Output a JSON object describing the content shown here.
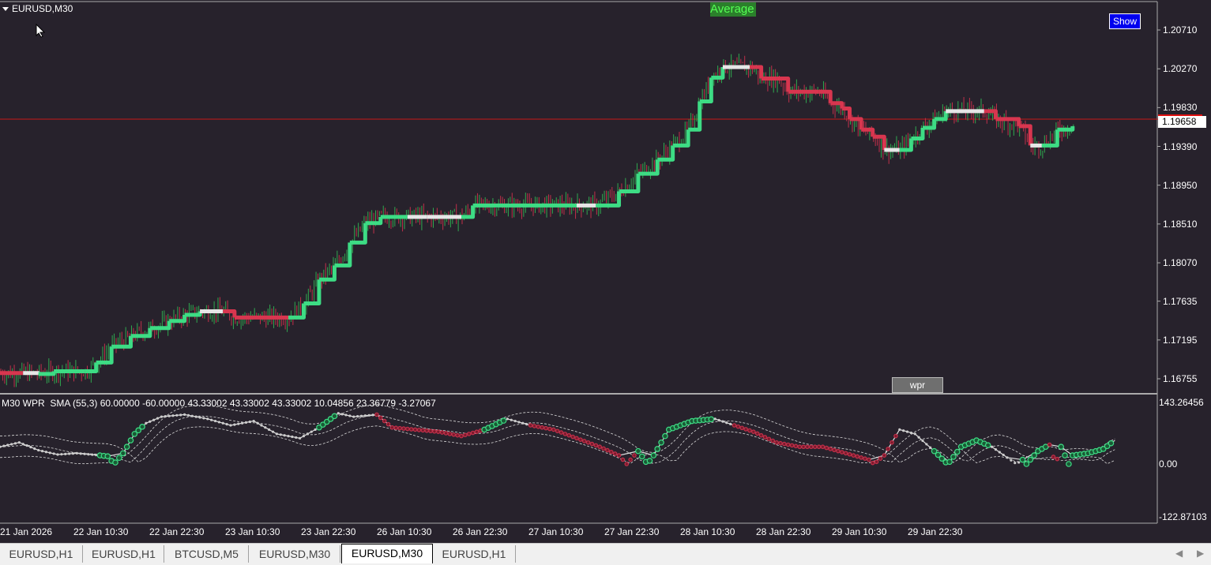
{
  "chart": {
    "symbol_title": "EURUSD,M30",
    "average_button": "Average",
    "show_button": "Show",
    "wpr_button": "wpr",
    "current_price": "1.19658",
    "price_axis": [
      "1.20710",
      "1.20270",
      "1.19830",
      "1.19390",
      "1.18950",
      "1.18510",
      "1.18070",
      "1.17635",
      "1.17195",
      "1.16755"
    ],
    "price_range": [
      1.1662,
      1.2095
    ],
    "colors": {
      "background": "#27222c",
      "bull_candle": "#2fa84f",
      "bear_candle": "#c0304a",
      "trend_up": "#3ddc84",
      "trend_down": "#d8364f",
      "trend_neutral": "#e6e6e6",
      "current_price_line": "#c81818"
    },
    "trend_line": [
      {
        "t": 0,
        "p": 1.1682,
        "s": "d"
      },
      {
        "t": 12,
        "p": 1.1682,
        "s": "d"
      },
      {
        "t": 20,
        "p": 1.1681,
        "s": "n"
      },
      {
        "t": 28,
        "p": 1.1684,
        "s": "u"
      },
      {
        "t": 44,
        "p": 1.1684,
        "s": "u"
      },
      {
        "t": 50,
        "p": 1.1694,
        "s": "u"
      },
      {
        "t": 58,
        "p": 1.1712,
        "s": "u"
      },
      {
        "t": 68,
        "p": 1.1724,
        "s": "u"
      },
      {
        "t": 78,
        "p": 1.1733,
        "s": "u"
      },
      {
        "t": 88,
        "p": 1.1741,
        "s": "u"
      },
      {
        "t": 96,
        "p": 1.1748,
        "s": "u"
      },
      {
        "t": 104,
        "p": 1.1752,
        "s": "u"
      },
      {
        "t": 116,
        "p": 1.1752,
        "s": "n"
      },
      {
        "t": 122,
        "p": 1.1745,
        "s": "d"
      },
      {
        "t": 150,
        "p": 1.1745,
        "s": "d"
      },
      {
        "t": 158,
        "p": 1.1761,
        "s": "u"
      },
      {
        "t": 166,
        "p": 1.1788,
        "s": "u"
      },
      {
        "t": 174,
        "p": 1.1804,
        "s": "u"
      },
      {
        "t": 182,
        "p": 1.183,
        "s": "u"
      },
      {
        "t": 190,
        "p": 1.1852,
        "s": "u"
      },
      {
        "t": 198,
        "p": 1.1859,
        "s": "u"
      },
      {
        "t": 212,
        "p": 1.1859,
        "s": "u"
      },
      {
        "t": 222,
        "p": 1.1859,
        "s": "n"
      },
      {
        "t": 240,
        "p": 1.1859,
        "s": "n"
      },
      {
        "t": 246,
        "p": 1.1872,
        "s": "u"
      },
      {
        "t": 300,
        "p": 1.1872,
        "s": "u"
      },
      {
        "t": 310,
        "p": 1.1872,
        "s": "n"
      },
      {
        "t": 322,
        "p": 1.1888,
        "s": "u"
      },
      {
        "t": 332,
        "p": 1.1908,
        "s": "u"
      },
      {
        "t": 342,
        "p": 1.1924,
        "s": "u"
      },
      {
        "t": 350,
        "p": 1.194,
        "s": "u"
      },
      {
        "t": 358,
        "p": 1.1958,
        "s": "u"
      },
      {
        "t": 364,
        "p": 1.199,
        "s": "u"
      },
      {
        "t": 370,
        "p": 1.2017,
        "s": "u"
      },
      {
        "t": 376,
        "p": 1.2029,
        "s": "u"
      },
      {
        "t": 390,
        "p": 1.2029,
        "s": "n"
      },
      {
        "t": 396,
        "p": 1.2016,
        "s": "d"
      },
      {
        "t": 404,
        "p": 1.2016,
        "s": "d"
      },
      {
        "t": 410,
        "p": 1.2001,
        "s": "d"
      },
      {
        "t": 426,
        "p": 1.2001,
        "s": "d"
      },
      {
        "t": 432,
        "p": 1.1988,
        "s": "d"
      },
      {
        "t": 438,
        "p": 1.1982,
        "s": "d"
      },
      {
        "t": 442,
        "p": 1.197,
        "s": "d"
      },
      {
        "t": 448,
        "p": 1.1958,
        "s": "d"
      },
      {
        "t": 454,
        "p": 1.195,
        "s": "d"
      },
      {
        "t": 460,
        "p": 1.1935,
        "s": "d"
      },
      {
        "t": 468,
        "p": 1.1935,
        "s": "n"
      },
      {
        "t": 474,
        "p": 1.1948,
        "s": "u"
      },
      {
        "t": 480,
        "p": 1.196,
        "s": "u"
      },
      {
        "t": 486,
        "p": 1.197,
        "s": "u"
      },
      {
        "t": 492,
        "p": 1.1979,
        "s": "u"
      },
      {
        "t": 512,
        "p": 1.1979,
        "s": "n"
      },
      {
        "t": 518,
        "p": 1.197,
        "s": "d"
      },
      {
        "t": 530,
        "p": 1.1962,
        "s": "d"
      },
      {
        "t": 536,
        "p": 1.194,
        "s": "d"
      },
      {
        "t": 542,
        "p": 1.194,
        "s": "n"
      },
      {
        "t": 550,
        "p": 1.1958,
        "s": "u"
      },
      {
        "t": 558,
        "p": 1.1962,
        "s": "u"
      }
    ],
    "candle_seed": 7
  },
  "indicator": {
    "title": "M30 WPR  SMA (55,3) 60.00000 -60.00000 43.33002 43.33002 43.33002 10.04856 23.36779 -3.27067",
    "axis": [
      "143.26456",
      "0.00",
      "-122.87103"
    ],
    "range": [
      -122.87103,
      143.26456
    ],
    "dot_colors": {
      "up": "#3ddc84",
      "down": "#c0304a",
      "neutral": "#cccccc"
    },
    "wpr": [
      {
        "t": 0,
        "v": -40,
        "s": "n"
      },
      {
        "t": 10,
        "v": -50,
        "s": "n"
      },
      {
        "t": 20,
        "v": -32,
        "s": "n"
      },
      {
        "t": 30,
        "v": -22,
        "s": "n"
      },
      {
        "t": 40,
        "v": -25,
        "s": "n"
      },
      {
        "t": 52,
        "v": -20,
        "s": "n"
      },
      {
        "t": 56,
        "v": -18,
        "s": "u"
      },
      {
        "t": 64,
        "v": 25,
        "s": "u"
      },
      {
        "t": 70,
        "v": 70,
        "s": "u"
      },
      {
        "t": 76,
        "v": 95,
        "s": "u"
      },
      {
        "t": 84,
        "v": 110,
        "s": "n"
      },
      {
        "t": 96,
        "v": 115,
        "s": "n"
      },
      {
        "t": 108,
        "v": 105,
        "s": "n"
      },
      {
        "t": 120,
        "v": 90,
        "s": "n"
      },
      {
        "t": 132,
        "v": 100,
        "s": "n"
      },
      {
        "t": 144,
        "v": 70,
        "s": "n"
      },
      {
        "t": 156,
        "v": 60,
        "s": "n"
      },
      {
        "t": 166,
        "v": 85,
        "s": "n"
      },
      {
        "t": 176,
        "v": 118,
        "s": "u"
      },
      {
        "t": 184,
        "v": 110,
        "s": "n"
      },
      {
        "t": 196,
        "v": 115,
        "s": "n"
      },
      {
        "t": 204,
        "v": 85,
        "s": "d"
      },
      {
        "t": 216,
        "v": 80,
        "s": "d"
      },
      {
        "t": 228,
        "v": 75,
        "s": "d"
      },
      {
        "t": 240,
        "v": 65,
        "s": "d"
      },
      {
        "t": 252,
        "v": 80,
        "s": "d"
      },
      {
        "t": 264,
        "v": 105,
        "s": "u"
      },
      {
        "t": 276,
        "v": 90,
        "s": "n"
      },
      {
        "t": 288,
        "v": 80,
        "s": "d"
      },
      {
        "t": 300,
        "v": 60,
        "s": "d"
      },
      {
        "t": 312,
        "v": 40,
        "s": "d"
      },
      {
        "t": 322,
        "v": 20,
        "s": "d"
      },
      {
        "t": 332,
        "v": -30,
        "s": "d"
      },
      {
        "t": 340,
        "v": 20,
        "s": "u"
      },
      {
        "t": 348,
        "v": 80,
        "s": "u"
      },
      {
        "t": 360,
        "v": 100,
        "s": "u"
      },
      {
        "t": 372,
        "v": 105,
        "s": "u"
      },
      {
        "t": 382,
        "v": 90,
        "s": "n"
      },
      {
        "t": 392,
        "v": 75,
        "s": "d"
      },
      {
        "t": 404,
        "v": 50,
        "s": "d"
      },
      {
        "t": 416,
        "v": 40,
        "s": "d"
      },
      {
        "t": 428,
        "v": 40,
        "s": "d"
      },
      {
        "t": 440,
        "v": 25,
        "s": "d"
      },
      {
        "t": 452,
        "v": 10,
        "s": "d"
      },
      {
        "t": 460,
        "v": -20,
        "s": "d"
      },
      {
        "t": 468,
        "v": -80,
        "s": "d"
      },
      {
        "t": 476,
        "v": -70,
        "s": "n"
      },
      {
        "t": 486,
        "v": -30,
        "s": "n"
      },
      {
        "t": 494,
        "v": 5,
        "s": "u"
      },
      {
        "t": 500,
        "v": 40,
        "s": "u"
      },
      {
        "t": 508,
        "v": 55,
        "s": "u"
      },
      {
        "t": 516,
        "v": 40,
        "s": "u"
      },
      {
        "t": 524,
        "v": 15,
        "s": "n"
      },
      {
        "t": 532,
        "v": -10,
        "s": "n"
      },
      {
        "t": 540,
        "v": 30,
        "s": "u"
      },
      {
        "t": 546,
        "v": 45,
        "s": "u"
      },
      {
        "t": 552,
        "v": -40,
        "s": "d"
      },
      {
        "t": 558,
        "v": 20,
        "s": "u"
      },
      {
        "t": 566,
        "v": 25,
        "s": "u"
      },
      {
        "t": 574,
        "v": 35,
        "s": "u"
      },
      {
        "t": 580,
        "v": 55,
        "s": "u"
      }
    ]
  },
  "time_axis": [
    "21 Jan 2026",
    "22 Jan 10:30",
    "22 Jan 22:30",
    "23 Jan 10:30",
    "23 Jan 22:30",
    "26 Jan 10:30",
    "26 Jan 22:30",
    "27 Jan 10:30",
    "27 Jan 22:30",
    "28 Jan 10:30",
    "28 Jan 22:30",
    "29 Jan 10:30",
    "29 Jan 22:30"
  ],
  "tabs": [
    "EURUSD,H1",
    "EURUSD,H1",
    "BTCUSD,M5",
    "EURUSD,M30",
    "EURUSD,M30",
    "EURUSD,H1"
  ],
  "active_tab": 4,
  "scroll": {
    "left": "◀",
    "right": "▶"
  }
}
